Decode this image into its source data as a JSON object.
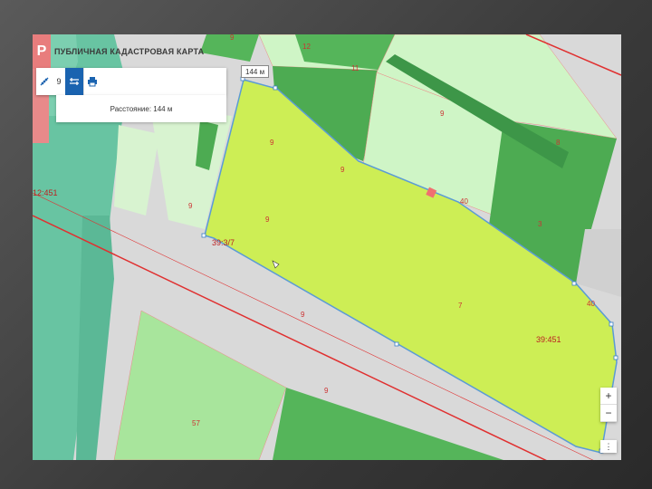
{
  "header": {
    "logo_glyph": "Р",
    "title": "ПУБЛИЧНАЯ КАДАСТРОВАЯ КАРТА"
  },
  "toolbar": {
    "ruler_icon": "ruler-icon",
    "ruler_count": "9",
    "distance_icon": "distance-measure-icon",
    "print_icon": "print-icon"
  },
  "measure": {
    "result_text": "Расстояние: 144 м"
  },
  "tooltip": {
    "text": "144 м"
  },
  "zoom": {
    "in_label": "+",
    "out_label": "−",
    "extra_label": "⋮"
  },
  "map_labels": {
    "l1": "9",
    "l2": "12",
    "l3": "11",
    "l4": "9",
    "l5": "9",
    "l6": "8",
    "l7": "9",
    "l8": "40",
    "l9": "9",
    "l10": "3",
    "l11": "9",
    "l12": "7",
    "l13": "9",
    "l14": "9",
    "l15": "57",
    "l16": "12:451",
    "l17": "39:3/7",
    "l18": "39:451",
    "l19": "40"
  },
  "colors": {
    "selected_parcel": "#cdee55",
    "dark_green": "#55b55a",
    "light_green": "#cff5c6",
    "teal": "#68c4a2",
    "boundary_red": "#e03030",
    "highlight_red": "#f07070"
  }
}
